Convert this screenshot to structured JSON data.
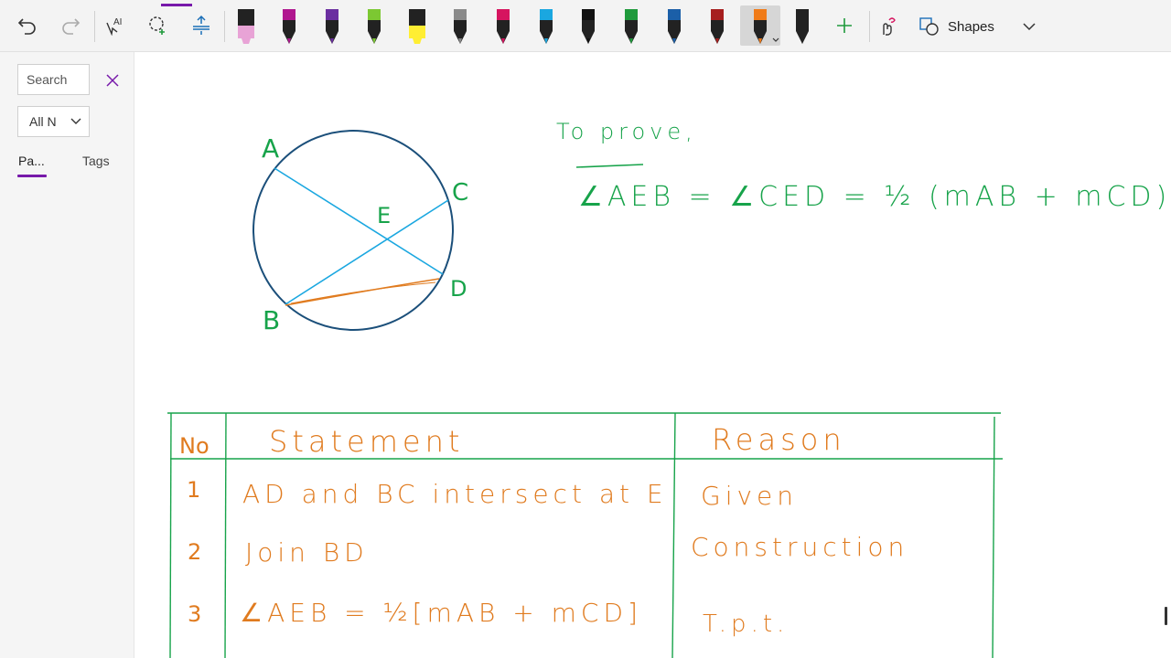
{
  "toolbar": {
    "icons": [
      "undo-icon",
      "redo-icon",
      "ink-to-text-icon",
      "lasso-select-icon",
      "add-space-icon"
    ],
    "pens": [
      {
        "name": "highlighter-pink",
        "color": "#e8a3d6"
      },
      {
        "name": "pen-magenta",
        "color": "#b0178f"
      },
      {
        "name": "pen-purple",
        "color": "#6b2fa0"
      },
      {
        "name": "pen-lime",
        "color": "#7cc832"
      },
      {
        "name": "highlighter-yellow",
        "color": "#ffee33"
      },
      {
        "name": "pen-galaxy",
        "color": "#8a8a8a"
      },
      {
        "name": "pen-crimson",
        "color": "#d6145f"
      },
      {
        "name": "pen-cyan",
        "color": "#1aa7e0"
      },
      {
        "name": "pen-black",
        "color": "#111111"
      },
      {
        "name": "pen-green",
        "color": "#1f9a3c"
      },
      {
        "name": "pen-blue",
        "color": "#1b5fa8"
      },
      {
        "name": "pen-darkred",
        "color": "#a61e1e"
      },
      {
        "name": "pen-orange",
        "color": "#f07b18",
        "selected": true
      },
      {
        "name": "pen-black-2",
        "color": "#222222"
      }
    ],
    "shapes_label": "Shapes"
  },
  "sidebar": {
    "search_placeholder": "Search",
    "filter_value": "All N",
    "tabs": [
      {
        "label": "Pa..."
      },
      {
        "label": "Tags"
      }
    ]
  },
  "ink": {
    "circle_labels": {
      "a": "A",
      "b": "B",
      "c": "C",
      "d": "D",
      "e": "E"
    },
    "to_prove": "To prove,",
    "equation": "∠AEB = ∠CED = ½ (mAB + mCD)",
    "table": {
      "headers": {
        "no": "No",
        "statement": "Statement",
        "reason": "Reason"
      },
      "rows": [
        {
          "no": "1",
          "statement": "AD and BC intersect at E",
          "reason": "Given"
        },
        {
          "no": "2",
          "statement": "Join BD",
          "reason": "Construction"
        },
        {
          "no": "3",
          "statement": "∠AEB = ½[mAB + mCD]",
          "reason": "T.p.t."
        }
      ]
    }
  },
  "colors": {
    "ink_green": "#17a34a",
    "ink_orange": "#e07b1f",
    "ink_blue": "#1aa7e0",
    "circle": "#1b4f7a",
    "accent": "#7719aa"
  }
}
